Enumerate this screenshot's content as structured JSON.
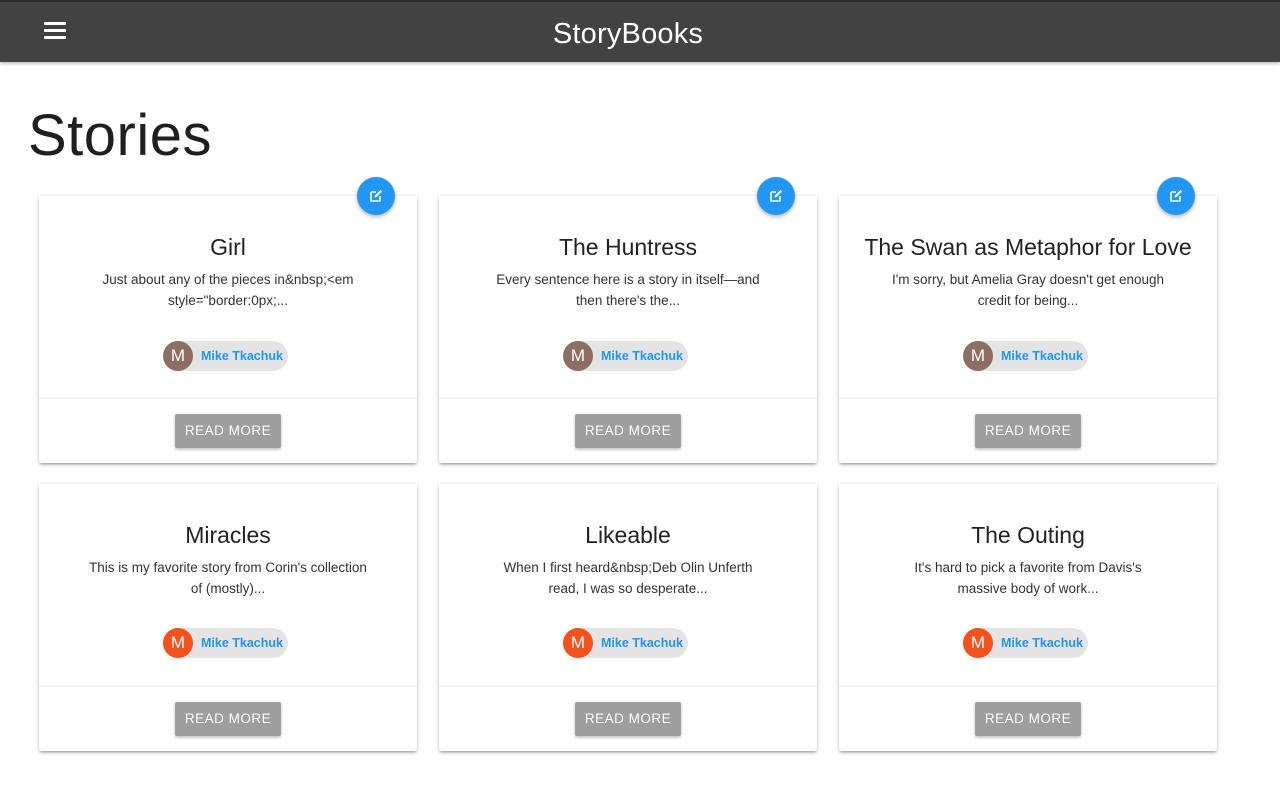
{
  "app": {
    "brand": "StoryBooks",
    "menu_icon": "hamburger-menu-icon"
  },
  "page": {
    "title": "Stories"
  },
  "colors": {
    "navbar": "#424242",
    "accent": "#2196f3",
    "button": "#9e9e9e",
    "avatar_brown": "#8d6e63",
    "avatar_orange": "#f4511e"
  },
  "stories": [
    {
      "title": "Girl",
      "excerpt": "Just about any of the pieces in&nbsp;<em style=\"border:0px;...",
      "author": "Mike Tkachuk",
      "avatar_letter": "M",
      "avatar_color": "#8d6e63",
      "button_label": "Read More",
      "editable": true
    },
    {
      "title": "The Huntress",
      "excerpt": "Every sentence here is a story in itself—and then there's the...",
      "author": "Mike Tkachuk",
      "avatar_letter": "M",
      "avatar_color": "#8d6e63",
      "button_label": "Read More",
      "editable": true
    },
    {
      "title": "The Swan as Metaphor for Love",
      "excerpt": "I'm sorry, but Amelia Gray doesn't get enough credit for being...",
      "author": "Mike Tkachuk",
      "avatar_letter": "M",
      "avatar_color": "#8d6e63",
      "button_label": "Read More",
      "editable": true
    },
    {
      "title": "Miracles",
      "excerpt": "This is my favorite story from Corin's collection of (mostly)...",
      "author": "Mike Tkachuk",
      "avatar_letter": "M",
      "avatar_color": "#f4511e",
      "button_label": "Read More",
      "editable": false
    },
    {
      "title": "Likeable",
      "excerpt": "When I first heard&nbsp;Deb Olin Unferth read, I was so desperate...",
      "author": "Mike Tkachuk",
      "avatar_letter": "M",
      "avatar_color": "#f4511e",
      "button_label": "Read More",
      "editable": false
    },
    {
      "title": "The Outing",
      "excerpt": "It's hard to pick a favorite from Davis's massive body of work...",
      "author": "Mike Tkachuk",
      "avatar_letter": "M",
      "avatar_color": "#f4511e",
      "button_label": "Read More",
      "editable": false
    }
  ]
}
